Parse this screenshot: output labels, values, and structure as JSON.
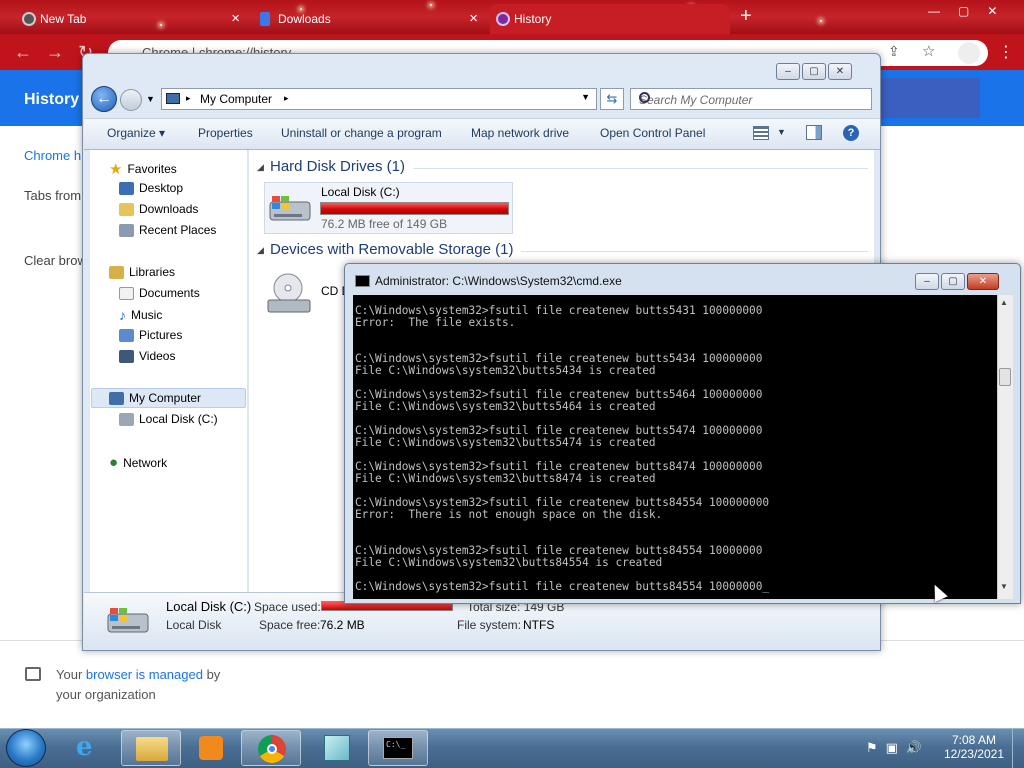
{
  "chrome": {
    "tabs": [
      {
        "label": "New Tab",
        "close": "×"
      },
      {
        "label": "Dowloads",
        "close": "×"
      },
      {
        "label": "History",
        "close": "×"
      }
    ],
    "new_tab": "+",
    "omnibox_text": "Chrome  |  chrome://history",
    "history_title": "History",
    "side_items": [
      "Chrome h",
      "Tabs from",
      "Clear brow"
    ],
    "managed_prefix": "Your ",
    "managed_link": "browser is managed",
    "managed_suffix": " by",
    "managed_line2": "your organization"
  },
  "explorer": {
    "address": "My Computer",
    "search_placeholder": "Search My Computer",
    "toolbar": {
      "organize": "Organize ▾",
      "properties": "Properties",
      "uninstall": "Uninstall or change a program",
      "map_drive": "Map network drive",
      "control_panel": "Open Control Panel",
      "help": "?"
    },
    "nav": {
      "favorites": "Favorites",
      "desktop": "Desktop",
      "downloads": "Downloads",
      "recent": "Recent Places",
      "libraries": "Libraries",
      "documents": "Documents",
      "music": "Music",
      "pictures": "Pictures",
      "videos": "Videos",
      "my_computer": "My Computer",
      "local_disk": "Local Disk (C:)",
      "network": "Network"
    },
    "groups": {
      "hdd": "Hard Disk Drives (1)",
      "removable": "Devices with Removable Storage (1)"
    },
    "disk": {
      "name": "Local Disk (C:)",
      "free_text": "76.2 MB free of 149 GB",
      "used_fraction": 0.9995
    },
    "cd_label": "CD D",
    "status": {
      "name": "Local Disk (C:)",
      "type": "Local Disk",
      "space_used_label": "Space used:",
      "space_free_label": "Space free:",
      "space_free": "76.2 MB",
      "total_size": "Total size: 149 GB",
      "fs_label": "File system:",
      "fs": "NTFS"
    }
  },
  "cmd": {
    "title": "Administrator: C:\\Windows\\System32\\cmd.exe",
    "output": "C:\\Windows\\system32>fsutil file createnew butts5431 100000000\nError:  The file exists.\n\n\nC:\\Windows\\system32>fsutil file createnew butts5434 100000000\nFile C:\\Windows\\system32\\butts5434 is created\n\nC:\\Windows\\system32>fsutil file createnew butts5464 100000000\nFile C:\\Windows\\system32\\butts5464 is created\n\nC:\\Windows\\system32>fsutil file createnew butts5474 100000000\nFile C:\\Windows\\system32\\butts5474 is created\n\nC:\\Windows\\system32>fsutil file createnew butts8474 100000000\nFile C:\\Windows\\system32\\butts8474 is created\n\nC:\\Windows\\system32>fsutil file createnew butts84554 100000000\nError:  There is not enough space on the disk.\n\n\nC:\\Windows\\system32>fsutil file createnew butts84554 10000000\nFile C:\\Windows\\system32\\butts84554 is created\n\nC:\\Windows\\system32>fsutil file createnew butts84554 10000000_"
  },
  "taskbar": {
    "time": "7:08 AM",
    "date": "12/23/2021"
  }
}
